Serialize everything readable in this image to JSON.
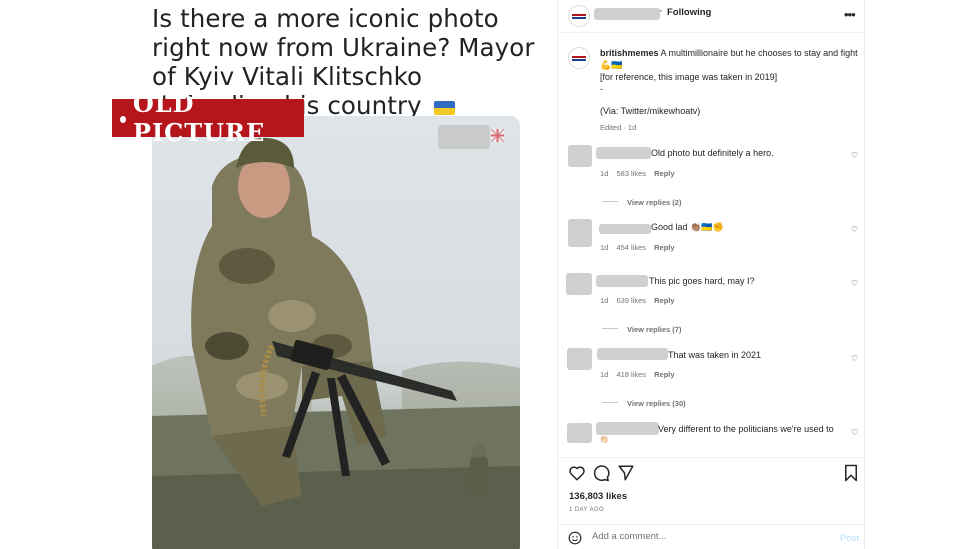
{
  "media": {
    "headline": "Is there a more iconic photo right now from Ukraine? Mayor of Kyiv Vitali Klitschko defending his country",
    "badge": "OLD PICTURE"
  },
  "header": {
    "separator": "·",
    "following_label": "Following",
    "more_icon": "more-horizontal-icon"
  },
  "post": {
    "author": "britishmemes",
    "caption_line1": "A multimillionaire but he chooses to stay and fight",
    "caption_emojis": "💪🇺🇦",
    "caption_line2": "[for reference, this image was taken in 2019]",
    "caption_dash": "-",
    "caption_via": "(Via: Twitter/mikewhoatv)",
    "meta": "Edited · 1d"
  },
  "comments": [
    {
      "text": "Old photo but definitely a hero.",
      "age": "1d",
      "likes": "583 likes",
      "reply": "Reply",
      "view_replies": "View replies (2)"
    },
    {
      "text": "Good lad 👏🏽🇺🇦✊",
      "age": "1d",
      "likes": "454 likes",
      "reply": "Reply",
      "view_replies": ""
    },
    {
      "text": "This pic goes hard, may I?",
      "age": "1d",
      "likes": "639 likes",
      "reply": "Reply",
      "view_replies": "View replies (7)"
    },
    {
      "text": "That was taken in 2021",
      "age": "1d",
      "likes": "418 likes",
      "reply": "Reply",
      "view_replies": "View replies (30)"
    },
    {
      "text": "Very different to the politicians we're used to",
      "extra": "👏🏻",
      "age": "",
      "likes": "",
      "reply": "",
      "view_replies": ""
    }
  ],
  "actions": {
    "like_icon": "heart-icon",
    "comment_icon": "comment-bubble-icon",
    "share_icon": "paper-plane-icon",
    "save_icon": "bookmark-icon",
    "likes": "136,803 likes",
    "ago": "1 DAY AGO"
  },
  "add_comment": {
    "placeholder": "Add a comment...",
    "post_label": "Post"
  },
  "colors": {
    "badge_red": "#b4161b",
    "post_button": "#b2dffc",
    "ukraine_blue": "#2f6cc1",
    "ukraine_yellow": "#f3c926"
  }
}
